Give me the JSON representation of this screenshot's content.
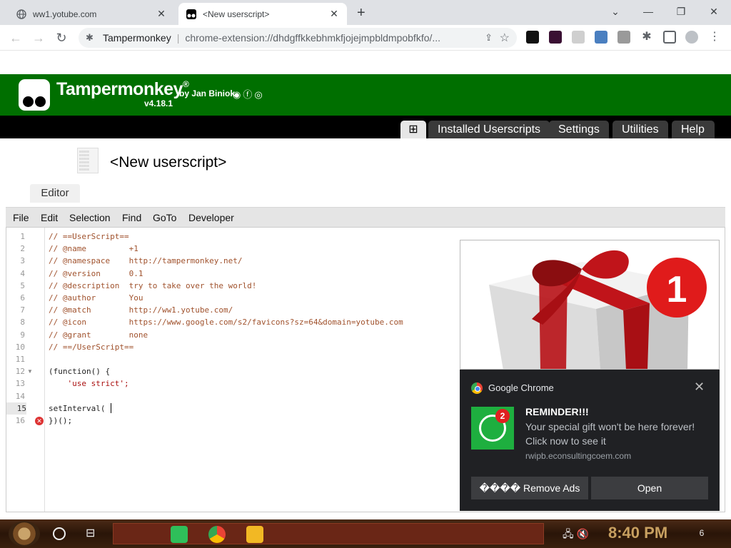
{
  "browser": {
    "tabs": [
      {
        "title": "ww1.yotube.com",
        "active": false
      },
      {
        "title": "<New userscript>",
        "active": true
      }
    ],
    "site_chip": "Tampermonkey",
    "url": "chrome-extension://dhdgffkkebhmkfjojejmpbldmpobfkfo/..."
  },
  "tampermonkey": {
    "name": "Tampermonkey",
    "registered": "®",
    "by": "by Jan Biniok",
    "version": "v4.18.1",
    "nav_tabs": [
      "Installed Userscripts",
      "Settings",
      "Utilities",
      "Help"
    ],
    "add_tab_symbol": "⊞"
  },
  "script": {
    "title": "<New userscript>",
    "editor_tab": "Editor"
  },
  "menu": [
    "File",
    "Edit",
    "Selection",
    "Find",
    "GoTo",
    "Developer"
  ],
  "code": {
    "active_line": 15,
    "error_line": 16,
    "lines": [
      "// ==UserScript==",
      "// @name         +1",
      "// @namespace    http://tampermonkey.net/",
      "// @version      0.1",
      "// @description  try to take over the world!",
      "// @author       You",
      "// @match        http://ww1.yotube.com/",
      "// @icon         https://www.google.com/s2/favicons?sz=64&domain=yotube.com",
      "// @grant        none",
      "// ==/UserScript==",
      "",
      "(function() {",
      "    'use strict';",
      "",
      "setInterval(",
      "})();"
    ]
  },
  "notification": {
    "app": "Google Chrome",
    "title": "REMINDER!!!",
    "body": "Your special gift won't be here forever! Click now to see it",
    "source": "rwipb.econsultingcoem.com",
    "badge_count": "2",
    "buttons": [
      "���� Remove Ads",
      "Open"
    ]
  },
  "gift": {
    "badge": "1"
  },
  "taskbar": {
    "time": "8:40 PM",
    "notification_count": "6"
  }
}
